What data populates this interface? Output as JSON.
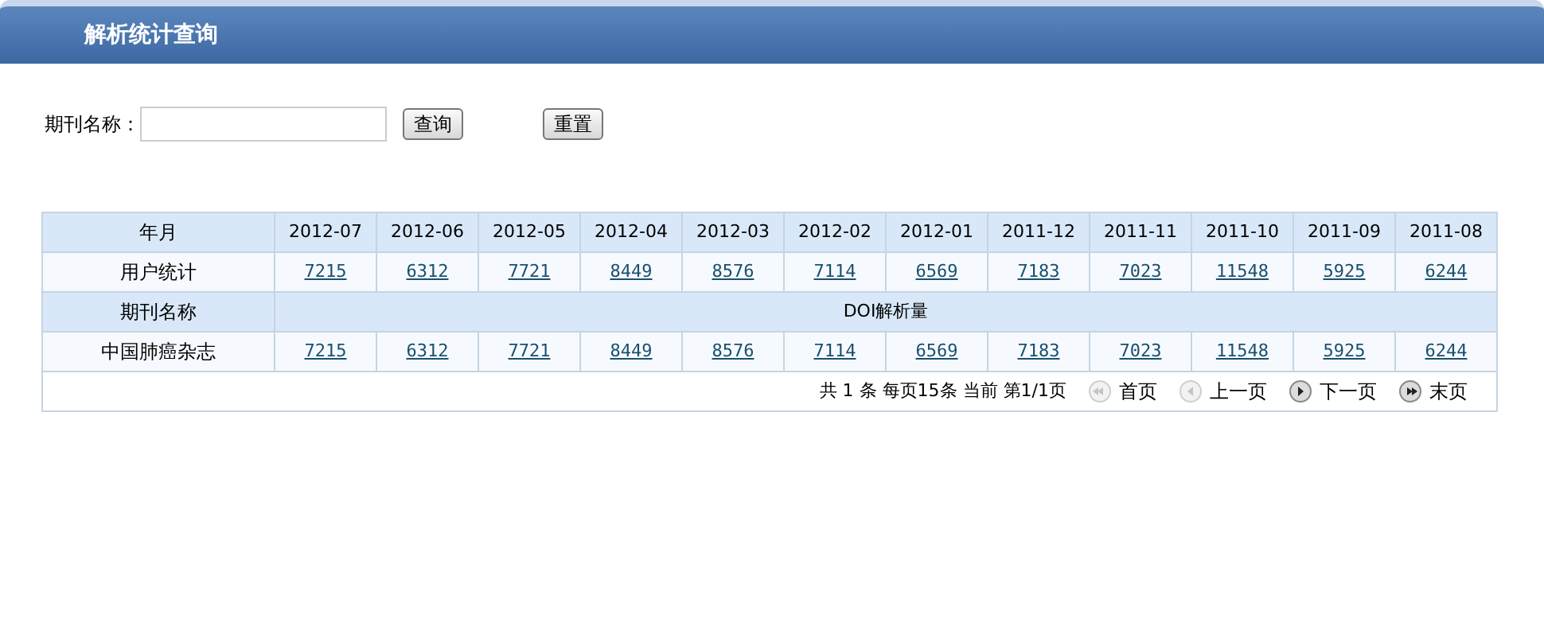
{
  "header": {
    "title": "解析统计查询"
  },
  "search": {
    "label": "期刊名称：",
    "buttons": [
      "查询",
      "重置"
    ]
  },
  "table": {
    "header_label": "年月",
    "months": [
      "2012-07",
      "2012-06",
      "2012-05",
      "2012-04",
      "2012-03",
      "2012-02",
      "2012-01",
      "2011-12",
      "2011-11",
      "2011-10",
      "2011-09",
      "2011-08"
    ],
    "user_row": {
      "label": "用户统计",
      "values": [
        "7215",
        "6312",
        "7721",
        "8449",
        "8576",
        "7114",
        "6569",
        "7183",
        "7023",
        "11548",
        "5925",
        "6244"
      ]
    },
    "section": {
      "label": "期刊名称",
      "title": "DOI解析量"
    },
    "journal_rows": [
      {
        "label": "中国肺癌杂志",
        "values": [
          "7215",
          "6312",
          "7721",
          "8449",
          "8576",
          "7114",
          "6569",
          "7183",
          "7023",
          "11548",
          "5925",
          "6244"
        ]
      }
    ]
  },
  "pager": {
    "summary": "共 1 条 每页15条 当前 第1/1页",
    "links": [
      {
        "label": "首页",
        "kind": "first",
        "disabled": true
      },
      {
        "label": "上一页",
        "kind": "prev",
        "disabled": true
      },
      {
        "label": "下一页",
        "kind": "next",
        "disabled": false
      },
      {
        "label": "末页",
        "kind": "last",
        "disabled": false
      }
    ]
  }
}
